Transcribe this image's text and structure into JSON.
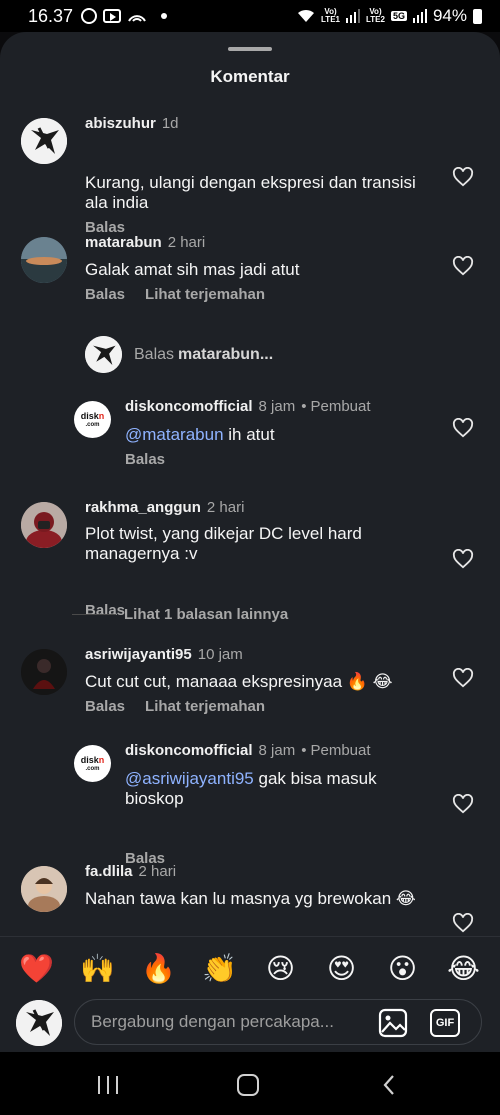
{
  "status_bar": {
    "time": "16.37",
    "carrier1_top": "Vo)",
    "carrier1_bottom": "LTE1",
    "carrier2_top": "Vo)",
    "carrier2_bottom": "LTE2",
    "network": "5G",
    "battery": "94%"
  },
  "sheet": {
    "title": "Komentar"
  },
  "comments": [
    {
      "username": "abiszuhur",
      "time": "1d",
      "text": "Kurang, ulangi dengan ekspresi dan transisi ala india",
      "reply_label": "Balas"
    },
    {
      "username": "matarabun",
      "time": "2 hari",
      "text": "Galak amat sih mas jadi atut",
      "reply_label": "Balas",
      "translate_label": "Lihat terjemahan"
    },
    {
      "username": "rakhma_anggun",
      "time": "2 hari",
      "text": "Plot twist, yang dikejar DC level hard managernya :v",
      "reply_label": "Balas"
    },
    {
      "username": "asriwijayanti95",
      "time": "10 jam",
      "text": "Cut cut cut, manaaa ekspresinyaa 🔥 😂",
      "reply_label": "Balas",
      "translate_label": "Lihat terjemahan"
    },
    {
      "username": "fa.dlila",
      "time": "2 hari",
      "text": "Nahan tawa kan lu masnya yg brewokan 😂",
      "reply_label": "Balas"
    }
  ],
  "reply_prompt": {
    "prefix": "Balas",
    "target": "matarabun..."
  },
  "replies": [
    {
      "username": "diskoncomofficial",
      "time": "8 jam",
      "badge": "Pembuat",
      "mention": "@matarabun",
      "text": " ih atut",
      "reply_label": "Balas",
      "avatar_text_a": "disk",
      "avatar_text_b": "n",
      "avatar_text_c": ".com"
    },
    {
      "username": "diskoncomofficial",
      "time": "8 jam",
      "badge": "Pembuat",
      "mention": "@asriwijayanti95",
      "text": " gak bisa masuk bioskop",
      "reply_label": "Balas",
      "avatar_text_a": "disk",
      "avatar_text_b": "n",
      "avatar_text_c": ".com"
    }
  ],
  "view_more": "Lihat 1 balasan lainnya",
  "separator": "•",
  "emojis": [
    "❤️",
    "🙌",
    "🔥",
    "👏",
    "😢",
    "😍",
    "😮",
    "😂"
  ],
  "input": {
    "placeholder": "Bergabung dengan percakapa...",
    "gif_label": "GIF"
  },
  "colors": {
    "background": "#1e2126",
    "mention": "#8fb3ff",
    "secondary_text": "#a8a8a8"
  }
}
